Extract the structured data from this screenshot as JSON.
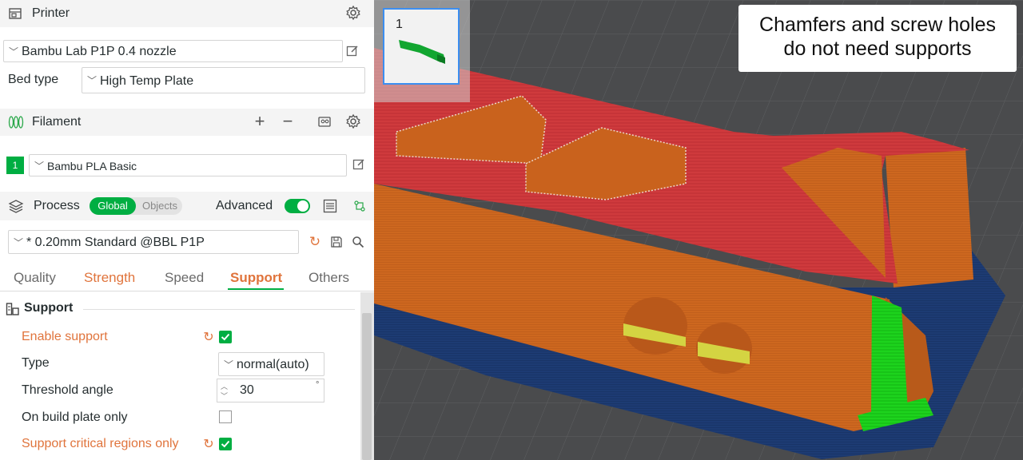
{
  "printer": {
    "title": "Printer",
    "preset": "Bambu Lab P1P 0.4 nozzle",
    "bed_type_label": "Bed type",
    "bed_type_value": "High Temp Plate"
  },
  "filament": {
    "title": "Filament",
    "slot_number": "1",
    "preset": "Bambu PLA Basic"
  },
  "process": {
    "title": "Process",
    "toggle_global": "Global",
    "toggle_objects": "Objects",
    "advanced_label": "Advanced",
    "preset": "* 0.20mm Standard @BBL P1P",
    "tabs": [
      "Quality",
      "Strength",
      "Speed",
      "Support",
      "Others"
    ],
    "active_tab": "Support"
  },
  "support": {
    "section_title": "Support",
    "enable_label": "Enable support",
    "type_label": "Type",
    "type_value": "normal(auto)",
    "threshold_label": "Threshold angle",
    "threshold_value": "30",
    "threshold_unit": "°",
    "build_plate_label": "On build plate only",
    "critical_label": "Support critical regions only"
  },
  "viewport": {
    "plate_number": "1",
    "annotation_line1": "Chamfers and screw holes",
    "annotation_line2": "do not need supports"
  },
  "colors": {
    "accent_green": "#00ae42",
    "orange": "#e0743c",
    "part_orange": "#c8651e",
    "top_red": "#d0393c",
    "base_blue": "#1a3a6e",
    "support_green": "#18d018"
  }
}
